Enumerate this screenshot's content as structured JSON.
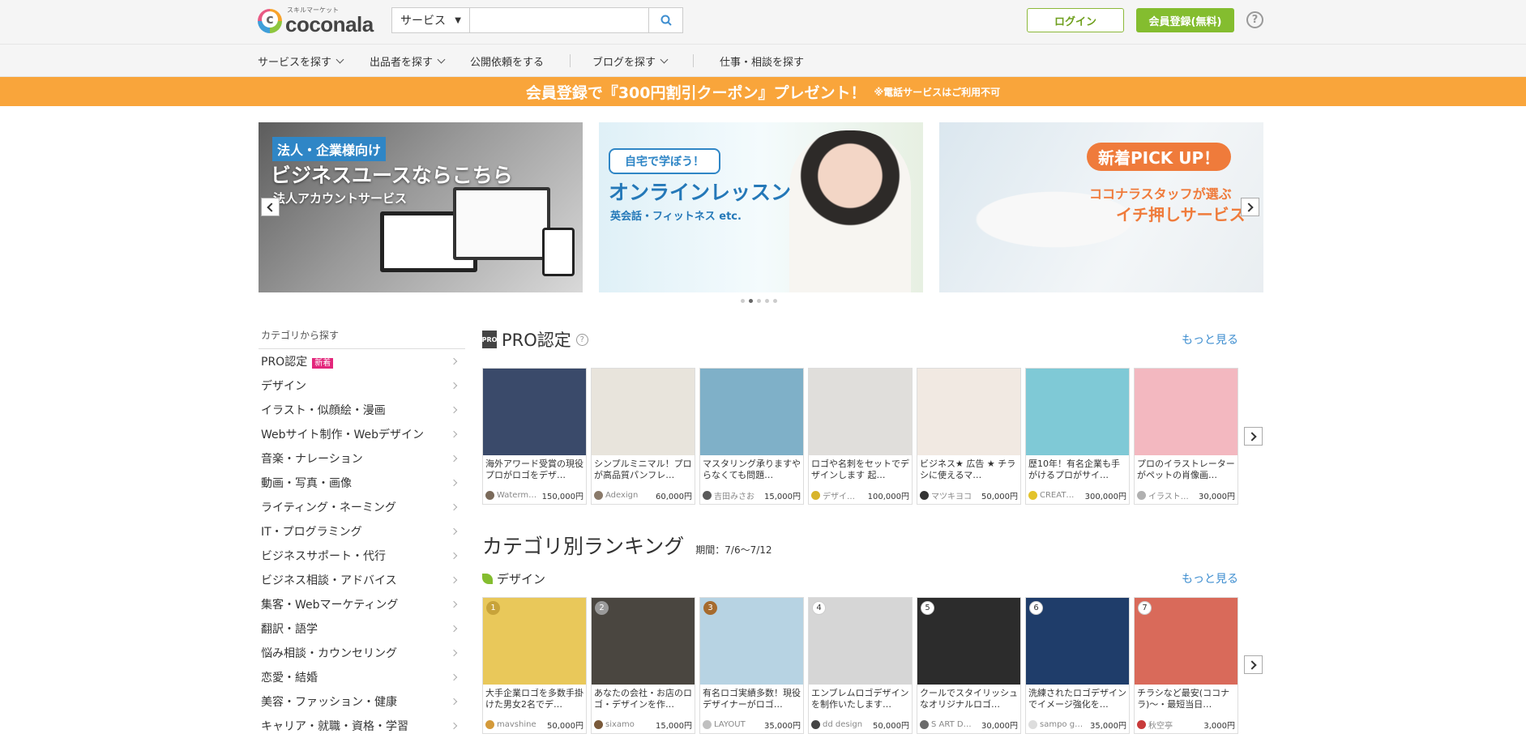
{
  "header": {
    "logo_sub": "スキルマーケット",
    "logo_name": "coconala",
    "search_select": "サービス",
    "search_placeholder": "",
    "login": "ログイン",
    "register": "会員登録(無料)",
    "help": "?"
  },
  "nav": {
    "items": [
      "サービスを探す",
      "出品者を探す",
      "公開依頼をする",
      "ブログを探す",
      "仕事・相談を探す"
    ]
  },
  "promo": {
    "main": "会員登録で『300円割引クーポン』プレゼント！",
    "note": "※電話サービスはご利用不可"
  },
  "banners": {
    "b1_tag": "法人・企業様向け",
    "b1_title": "ビジネスユースならこちら",
    "b1_sub": "法人アカウントサービス",
    "b2_bubble": "自宅で学ぼう！",
    "b2_title": "オンラインレッスン",
    "b2_sub": "英会話・フィットネス etc.",
    "b3_pill": "新着PICK UP！",
    "b3_l1": "ココナラスタッフが選ぶ",
    "b3_l2": "イチ押しサービス"
  },
  "sidebar": {
    "title": "カテゴリから探す",
    "new_badge": "新着",
    "items": [
      "PRO認定",
      "デザイン",
      "イラスト・似顔絵・漫画",
      "Webサイト制作・Webデザイン",
      "音楽・ナレーション",
      "動画・写真・画像",
      "ライティング・ネーミング",
      "IT・プログラミング",
      "ビジネスサポート・代行",
      "ビジネス相談・アドバイス",
      "集客・Webマーケティング",
      "翻訳・語学",
      "悩み相談・カウンセリング",
      "恋愛・結婚",
      "美容・ファッション・健康",
      "キャリア・就職・資格・学習"
    ]
  },
  "pro": {
    "badge": "PRO",
    "title": "PRO認定",
    "more": "もっと見る",
    "cards": [
      {
        "title": "海外アワード受賞の現役プロがロゴをデザ…",
        "seller": "Waterm…",
        "price": "150,000円",
        "img": "#3a4a6a",
        "av": "#7a6a5a"
      },
      {
        "title": "シンプルミニマル！プロが高品質パンフレ…",
        "seller": "Adexign",
        "price": "60,000円",
        "img": "#e8e4dc",
        "av": "#8a7a6a"
      },
      {
        "title": "マスタリング承りますやらなくても問題…",
        "seller": "吉田みさお",
        "price": "15,000円",
        "img": "#7fb0c8",
        "av": "#5a5a5a"
      },
      {
        "title": "ロゴや名刺をセットでデザインします 起…",
        "seller": "デザイ…",
        "price": "100,000円",
        "img": "#e0dedb",
        "av": "#d8b42a"
      },
      {
        "title": "ビジネス★ 広告 ★ チラシに使えるマ…",
        "seller": "マツキヨコ",
        "price": "50,000円",
        "img": "#f1e9e2",
        "av": "#333333"
      },
      {
        "title": "歴10年！有名企業も手がけるプロがサイ…",
        "seller": "CREAT…",
        "price": "300,000円",
        "img": "#7fc9d6",
        "av": "#e3c32a"
      },
      {
        "title": "プロのイラストレーターがペットの肖像画…",
        "seller": "イラスト…",
        "price": "30,000円",
        "img": "#f3b8c0",
        "av": "#b0b0b0"
      }
    ]
  },
  "ranking": {
    "title": "カテゴリ別ランキング",
    "period": "期間：7/6〜7/12",
    "sub_title": "デザイン",
    "more": "もっと見る",
    "cards": [
      {
        "rank": "1",
        "title": "大手企業ロゴを多数手掛けた男女2名でデ…",
        "seller": "mavshine",
        "price": "50,000円",
        "img": "#e9c85a",
        "av": "#d49a3a"
      },
      {
        "rank": "2",
        "title": "あなたの会社・お店のロゴ・デザインを作…",
        "seller": "sixamo",
        "price": "15,000円",
        "img": "#4a4640",
        "av": "#7a5a3a"
      },
      {
        "rank": "3",
        "title": "有名ロゴ実績多数！現役デザイナーがロゴ…",
        "seller": "LAYOUT",
        "price": "35,000円",
        "img": "#b7d3e3",
        "av": "#c0c0c0"
      },
      {
        "rank": "4",
        "title": "エンブレムロゴデザインを制作いたします…",
        "seller": "dd design",
        "price": "50,000円",
        "img": "#d6d6d6",
        "av": "#444444"
      },
      {
        "rank": "5",
        "title": "クールでスタイリッシュなオリジナルロゴ…",
        "seller": "S ART D…",
        "price": "30,000円",
        "img": "#2c2c2c",
        "av": "#6a6a6a"
      },
      {
        "rank": "6",
        "title": "洗練されたロゴデザインでイメージ強化を…",
        "seller": "sampo g…",
        "price": "35,000円",
        "img": "#1f3d6a",
        "av": "#dddddd"
      },
      {
        "rank": "7",
        "title": "チラシなど最安(ココナラ)〜・最短当日…",
        "seller": "秋空亭",
        "price": "3,000円",
        "img": "#d96a5a",
        "av": "#c83a3a"
      }
    ]
  }
}
